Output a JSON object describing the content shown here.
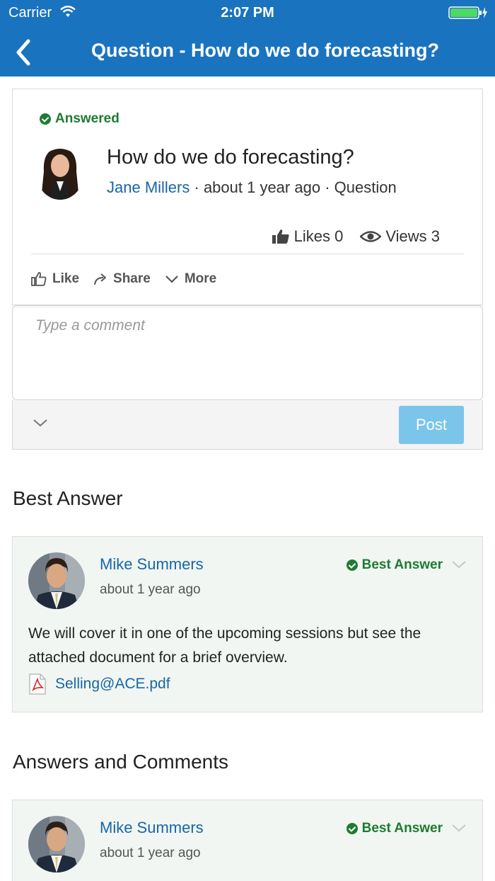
{
  "status_bar": {
    "carrier": "Carrier",
    "time": "2:07 PM"
  },
  "nav": {
    "title": "Question - How do we do forecasting?"
  },
  "question": {
    "status": "Answered",
    "title": "How do we do forecasting?",
    "author": "Jane Millers",
    "sep1": " · ",
    "time": "about 1 year ago",
    "sep2": " · ",
    "type": "Question",
    "likes": "Likes 0",
    "views": "Views 3"
  },
  "actions": {
    "like": "Like",
    "share": "Share",
    "more": "More"
  },
  "comment": {
    "placeholder": "Type a comment",
    "post": "Post"
  },
  "best_answer_section": {
    "title": "Best Answer"
  },
  "best_answer": {
    "author": "Mike Summers",
    "time": "about 1 year ago",
    "badge": "Best Answer",
    "body": "We will cover it in one of the upcoming sessions but see the attached document for a brief overview.",
    "attachment": "Selling@ACE.pdf"
  },
  "answers_section": {
    "title": "Answers and Comments"
  },
  "answers": [
    {
      "author": "Mike Summers",
      "time": "about 1 year ago",
      "badge": "Best Answer"
    }
  ],
  "colors": {
    "header": "#1a73be",
    "link": "#1866a8",
    "success": "#1f7a33",
    "post_button": "#7cc5ea",
    "answer_bg": "#f1f6f2"
  }
}
